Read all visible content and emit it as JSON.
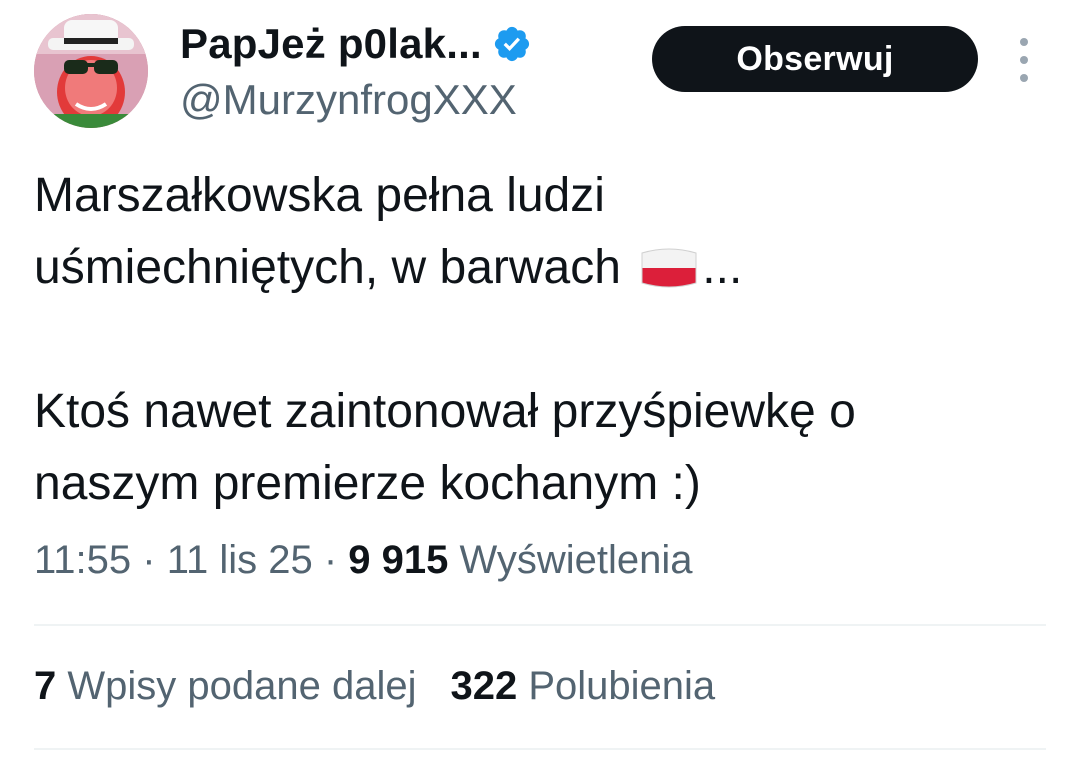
{
  "author": {
    "display_name": "PapJeż p0lak...",
    "handle": "@MurzynfrogXXX",
    "verified": true
  },
  "follow_button": {
    "label": "Obserwuj"
  },
  "more_icon": "more-vertical-icon",
  "tweet": {
    "line1": "Marszałkowska pełna ludzi",
    "line2_before_flag": "uśmiechniętych, w barwach ",
    "flag_icon": "poland-flag-icon",
    "line2_after_flag": "...",
    "line3": "Ktoś nawet zaintonował przyśpiewkę o",
    "line4": "naszym premierze kochanym :)"
  },
  "meta": {
    "time": "11:55",
    "sep": " · ",
    "date": "11 lis 25",
    "views_count": "9 915",
    "views_label": "Wyświetlenia"
  },
  "stats": {
    "reposts_count": "7",
    "reposts_label": "Wpisy podane dalej",
    "likes_count": "322",
    "likes_label": "Polubienia"
  },
  "colors": {
    "text_primary": "#0f1419",
    "text_secondary": "#536471",
    "verified": "#1d9bf0",
    "button_bg": "#0f1419",
    "divider": "#eff3f4"
  }
}
